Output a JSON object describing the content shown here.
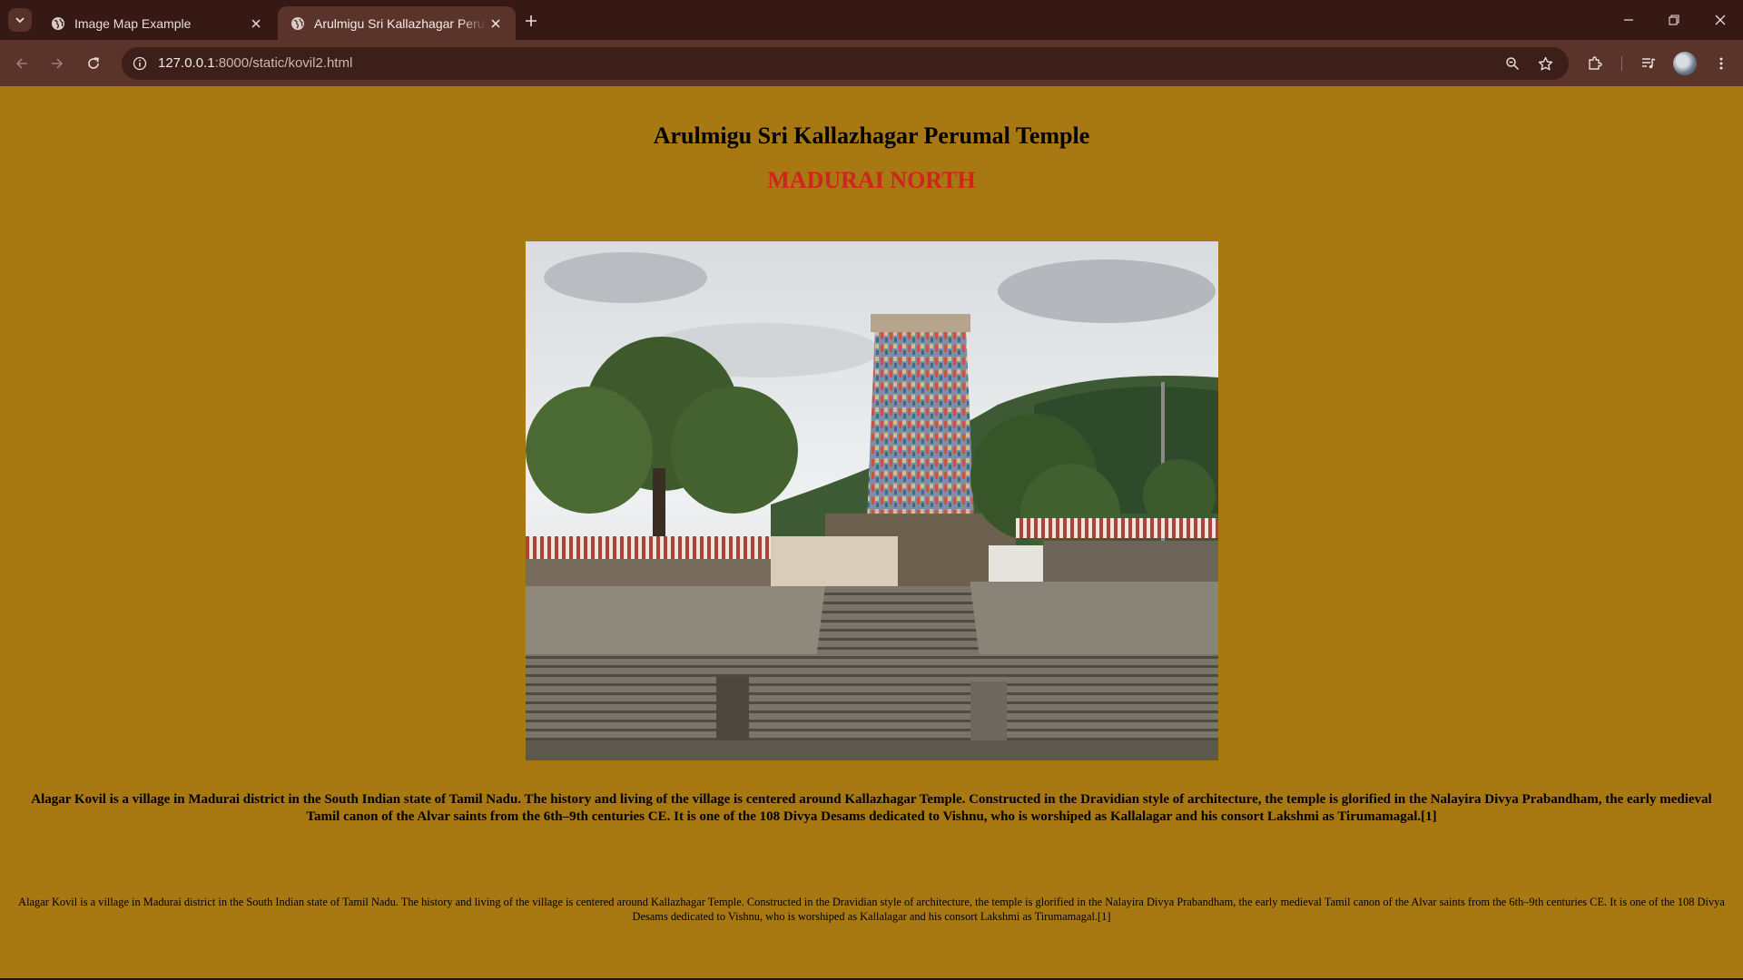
{
  "browser": {
    "tabs": [
      {
        "title": "Image Map Example",
        "favicon": "globe-icon",
        "active": false
      },
      {
        "title": "Arulmigu Sri Kallazhagar Perumal Temple",
        "favicon": "globe-icon",
        "active": true
      }
    ],
    "address": {
      "host": "127.0.0.1",
      "path": ":8000/static/kovil2.html"
    },
    "colors": {
      "frame": "#361914",
      "toolbar": "#5a332b",
      "omnibox": "#3c1f19"
    }
  },
  "page": {
    "background": "#a87813",
    "title": "Arulmigu Sri Kallazhagar Perumal Temple",
    "subtitle": "MADURAI NORTH",
    "subtitle_color": "#d0241d",
    "paragraph": "Alagar Kovil is a village in Madurai district in the South Indian state of Tamil Nadu. The history and living of the village is centered around Kallazhagar Temple. Constructed in the Dravidian style of architecture, the temple is glorified in the Nalayira Divya Prabandham, the early medieval Tamil canon of the Alvar saints from the 6th–9th centuries CE. It is one of the 108 Divya Desams dedicated to Vishnu, who is worshiped as Kallalagar and his consort Lakshmi as Tirumamagal.[1]",
    "paragraph_small": "Alagar Kovil is a village in Madurai district in the South Indian state of Tamil Nadu. The history and living of the village is centered around Kallazhagar Temple. Constructed in the Dravidian style of architecture, the temple is glorified in the Nalayira Divya Prabandham, the early medieval Tamil canon of the Alvar saints from the 6th–9th centuries CE. It is one of the 108 Divya Desams dedicated to Vishnu, who is worshiped as Kallalagar and his consort Lakshmi as Tirumamagal.[1]"
  }
}
